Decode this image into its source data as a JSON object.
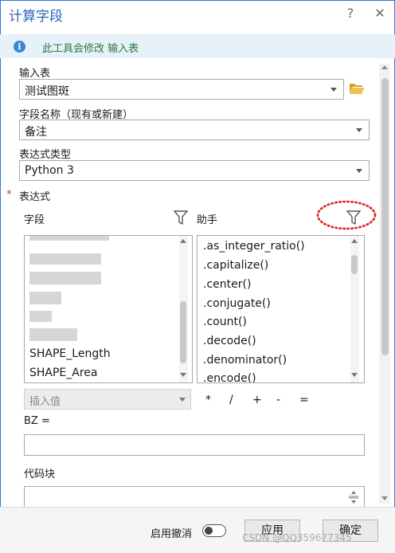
{
  "window": {
    "title": "计算字段",
    "help_label": "?",
    "close_label": "✕"
  },
  "info": {
    "message": "此工具会修改 输入表"
  },
  "input_table": {
    "label": "输入表",
    "value": "测试图斑"
  },
  "field_name": {
    "label": "字段名称（现有或新建）",
    "value": "备注"
  },
  "expression_type": {
    "label": "表达式类型",
    "value": "Python 3"
  },
  "expression": {
    "required_mark": "*",
    "label": "表达式",
    "fields_header": "字段",
    "helpers_header": "助手",
    "fields": [
      "SHAPE_Length",
      "SHAPE_Area"
    ],
    "helpers": [
      ".as_integer_ratio()",
      ".capitalize()",
      ".center()",
      ".conjugate()",
      ".count()",
      ".decode()",
      ".denominator()",
      ".encode()"
    ],
    "insert_value_placeholder": "插入值",
    "operators": [
      "*",
      "/",
      "+",
      "-",
      "="
    ],
    "target_label": "BZ ="
  },
  "code_block": {
    "label": "代码块"
  },
  "footer": {
    "enable_undo_label": "启用撤消",
    "apply_label": "应用",
    "ok_label": "确定"
  },
  "watermark": "CSDN @QQ359677345",
  "colors": {
    "accent": "#2a7bd4",
    "info_bg": "#e6f1fa",
    "info_text": "#2a7a3a",
    "highlight_dash": "#e02020"
  }
}
